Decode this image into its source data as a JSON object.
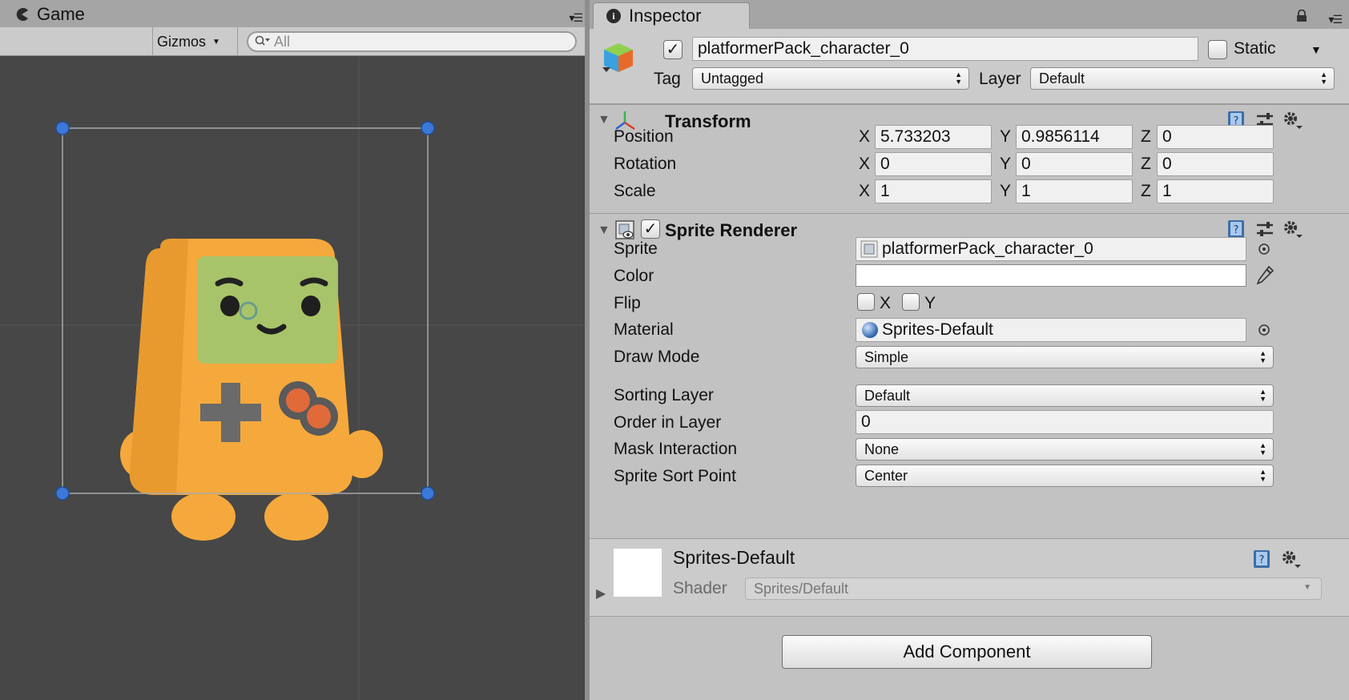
{
  "game": {
    "tab_title": "Game",
    "gizmos_label": "Gizmos",
    "search_placeholder": "All"
  },
  "inspector": {
    "tab_title": "Inspector",
    "object": {
      "active": true,
      "name": "platformerPack_character_0",
      "static_label": "Static",
      "static_checked": false,
      "tag_label": "Tag",
      "tag_value": "Untagged",
      "layer_label": "Layer",
      "layer_value": "Default"
    },
    "transform": {
      "title": "Transform",
      "position": {
        "label": "Position",
        "x": "5.733203",
        "y": "0.9856114",
        "z": "0"
      },
      "rotation": {
        "label": "Rotation",
        "x": "0",
        "y": "0",
        "z": "0"
      },
      "scale": {
        "label": "Scale",
        "x": "1",
        "y": "1",
        "z": "1"
      },
      "axis_x": "X",
      "axis_y": "Y",
      "axis_z": "Z"
    },
    "sprite_renderer": {
      "title": "Sprite Renderer",
      "enabled": true,
      "sprite_label": "Sprite",
      "sprite_value": "platformerPack_character_0",
      "color_label": "Color",
      "color_value": "#ffffff",
      "flip_label": "Flip",
      "flip_x": "X",
      "flip_y": "Y",
      "material_label": "Material",
      "material_value": "Sprites-Default",
      "draw_mode_label": "Draw Mode",
      "draw_mode_value": "Simple",
      "sorting_layer_label": "Sorting Layer",
      "sorting_layer_value": "Default",
      "order_label": "Order in Layer",
      "order_value": "0",
      "mask_label": "Mask Interaction",
      "mask_value": "None",
      "sort_point_label": "Sprite Sort Point",
      "sort_point_value": "Center"
    },
    "material": {
      "name": "Sprites-Default",
      "shader_label": "Shader",
      "shader_value": "Sprites/Default"
    },
    "add_component_label": "Add Component"
  },
  "colors": {
    "game_bg": "#474747",
    "character_orange": "#f5a93c",
    "screen_green": "#a8c46a",
    "handle_blue": "#3c78d8"
  }
}
